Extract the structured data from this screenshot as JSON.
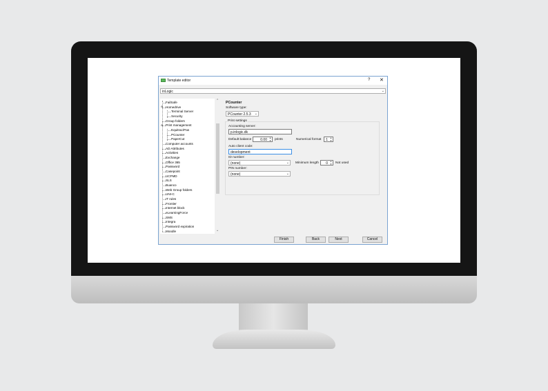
{
  "window": {
    "title": "Template editor",
    "help": "?",
    "close": "✕"
  },
  "template_select": {
    "value": "inLogic",
    "arrow": "⌄"
  },
  "tree": {
    "items": [
      "FailSafe",
      "Homedrive",
      "Terminal Server",
      "Security",
      "Group folders",
      "Print management",
      "Equitrac/Pas",
      "PCounter",
      "PaperCut",
      "Computer accounts",
      "AD Attributes",
      "Activities",
      "Exchange",
      "Office 365",
      "Password",
      "Casepoint",
      "UCFMD",
      "SLS",
      "Buanco",
      "Web Group folders",
      "UNI-C",
      "IT rules",
      "Frontier",
      "Internet block",
      "eLearningForce",
      "SMS",
      "Integra",
      "Password expiration",
      "Moodle"
    ],
    "scroll_up": "⌃",
    "scroll_down": "⌄"
  },
  "panel": {
    "title": "PCounter",
    "software_type_label": "Software type:",
    "software_type_value": "PCounter 2.5.3",
    "print_settings_label": "Print settings",
    "accounting_server_label": "Accounting server:",
    "accounting_server_value": "p.inlogic.dk",
    "default_balance_label": "Default balance",
    "default_balance_value": "0.00",
    "default_balance_unit": "prints",
    "numerical_format_label": "Numerical format",
    "numerical_format_value": "1",
    "auto_client_code_label": "Auto client code:",
    "auto_client_code_value": "development",
    "id_number_label": "ID number:",
    "id_number_value": "(none)",
    "minimum_length_label": "Minimum length",
    "minimum_length_value": "0",
    "not_used_label": "Not used",
    "pin_number_label": "PIN number:",
    "pin_number_value": "(none)"
  },
  "buttons": {
    "finish": "Finish",
    "back": "Back",
    "next": "Next",
    "cancel": "Cancel"
  },
  "colors": {
    "accent": "#3a8ee6",
    "monitor_bezel": "#151515",
    "app_icon": "#5cb85c"
  }
}
